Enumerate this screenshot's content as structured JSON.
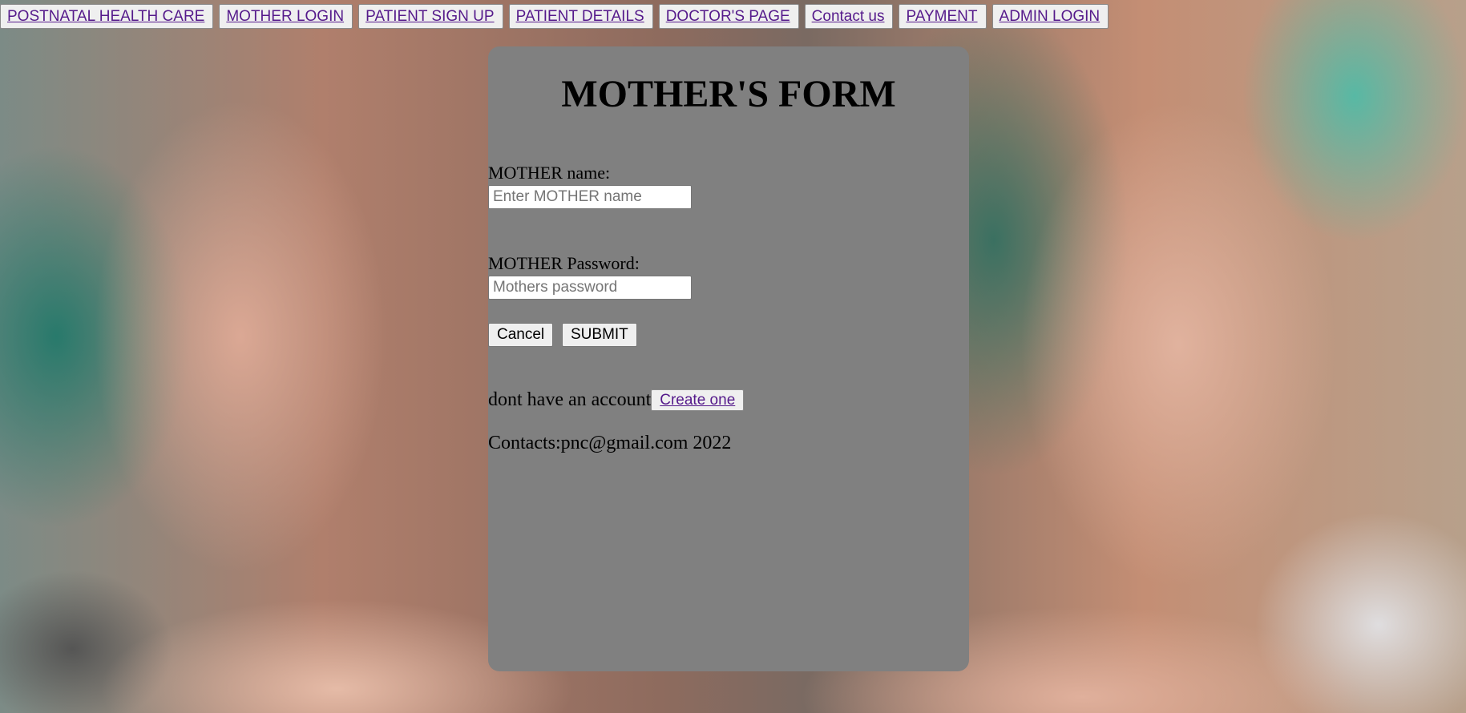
{
  "nav": {
    "items": [
      {
        "label": "POSTNATAL HEALTH CARE"
      },
      {
        "label": "MOTHER LOGIN"
      },
      {
        "label": "PATIENT SIGN UP"
      },
      {
        "label": "PATIENT DETAILS"
      },
      {
        "label": "DOCTOR'S PAGE"
      },
      {
        "label": "Contact us"
      },
      {
        "label": "PAYMENT"
      },
      {
        "label": "ADMIN LOGIN"
      }
    ]
  },
  "form": {
    "title": "MOTHER'S FORM",
    "name_label": "MOTHER name:",
    "name_placeholder": "Enter MOTHER name",
    "name_value": "",
    "password_label": "MOTHER Password:",
    "password_placeholder": "Mothers password",
    "password_value": "",
    "cancel_label": "Cancel",
    "submit_label": "SUBMIT",
    "account_prompt": "dont have an account",
    "create_link_label": "Create one",
    "contacts": "Contacts:pnc@gmail.com 2022"
  },
  "colors": {
    "card_background": "#808080",
    "link_color": "#551a8b",
    "button_background": "#efefef"
  }
}
